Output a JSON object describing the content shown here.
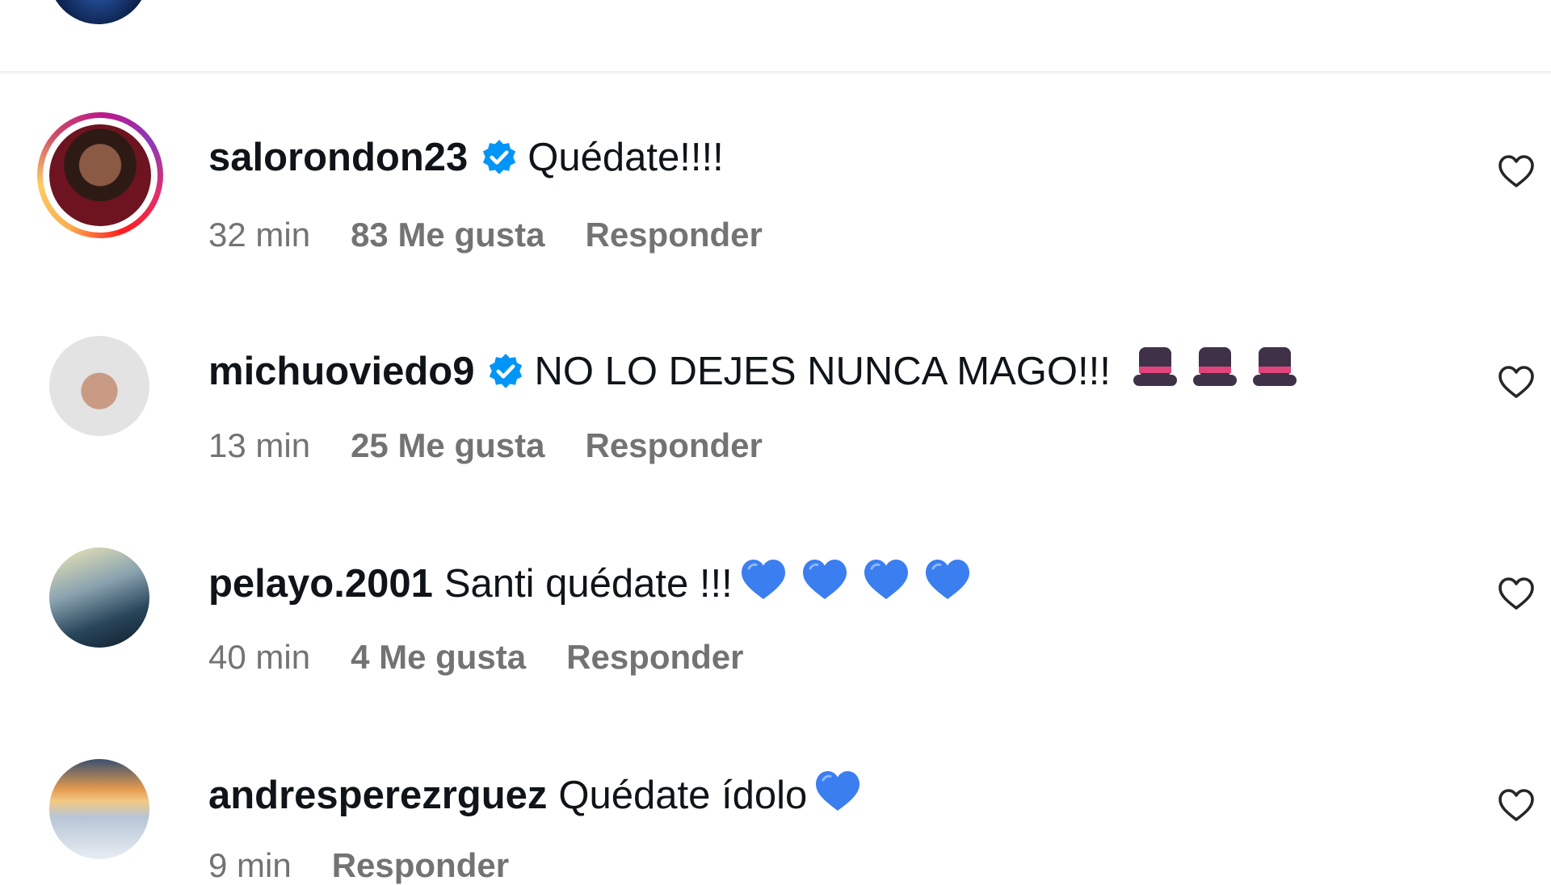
{
  "comments": [
    {
      "username": "salorondon23",
      "verified": true,
      "text": "Quédate!!!!",
      "emoji": [],
      "time": "32 min",
      "likes": "83 Me gusta",
      "reply": "Responder",
      "story_ring": true
    },
    {
      "username": "michuoviedo9",
      "verified": true,
      "text": "NO LO DEJES NUNCA MAGO!!!",
      "emoji": [
        "top-hat-icon",
        "top-hat-icon",
        "top-hat-icon"
      ],
      "time": "13 min",
      "likes": "25 Me gusta",
      "reply": "Responder",
      "story_ring": false
    },
    {
      "username": "pelayo.2001",
      "verified": false,
      "text": "Santi quédate !!!",
      "emoji": [
        "blue-heart-icon",
        "blue-heart-icon",
        "blue-heart-icon",
        "blue-heart-icon"
      ],
      "time": "40 min",
      "likes": "4 Me gusta",
      "reply": "Responder",
      "story_ring": false
    },
    {
      "username": "andresperezrguez",
      "verified": false,
      "text": "Quédate ídolo",
      "emoji": [
        "blue-heart-icon"
      ],
      "time": "9 min",
      "likes": "",
      "reply": "Responder",
      "story_ring": false
    }
  ],
  "colors": {
    "verified_blue": "#0095f6",
    "secondary_text": "#737373",
    "primary_text": "#0f1419",
    "blue_heart": "#3b7ef0"
  }
}
